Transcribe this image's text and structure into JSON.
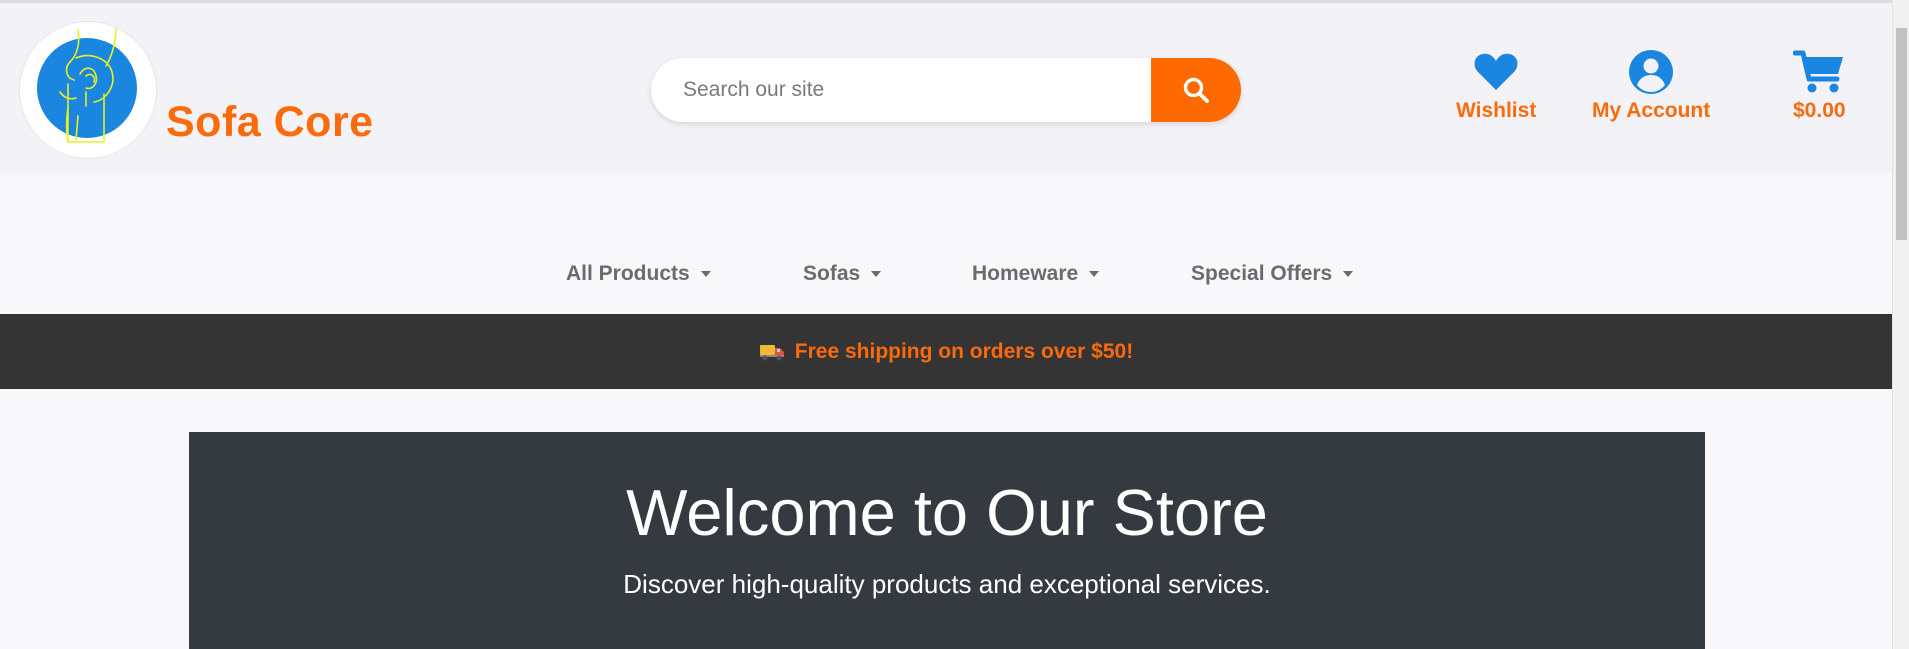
{
  "brand": {
    "name": "Sofa Core",
    "logo_icon": "shopping-bag-hand-icon"
  },
  "search": {
    "placeholder": "Search our site",
    "value": "",
    "icon": "search-icon"
  },
  "header_actions": [
    {
      "label": "Wishlist",
      "icon": "heart-icon"
    },
    {
      "label": "My Account",
      "icon": "user-icon"
    },
    {
      "label": "$0.00",
      "icon": "cart-icon"
    }
  ],
  "nav": {
    "items": [
      {
        "label": "All Products"
      },
      {
        "label": "Sofas"
      },
      {
        "label": "Homeware"
      },
      {
        "label": "Special Offers"
      }
    ]
  },
  "shipping_bar": {
    "icon": "delivery-truck-icon",
    "text": "Free shipping on orders over $50!"
  },
  "hero": {
    "title": "Welcome to Our Store",
    "subtitle": "Discover high-quality products and exceptional services."
  },
  "colors": {
    "accent": "#fb6a0b",
    "search_button": "#ff6a00",
    "icon_blue": "#1a86e0",
    "header_bg": "#f3f2f7",
    "ship_bar_bg": "#343434",
    "hero_bg": "#343a40"
  }
}
